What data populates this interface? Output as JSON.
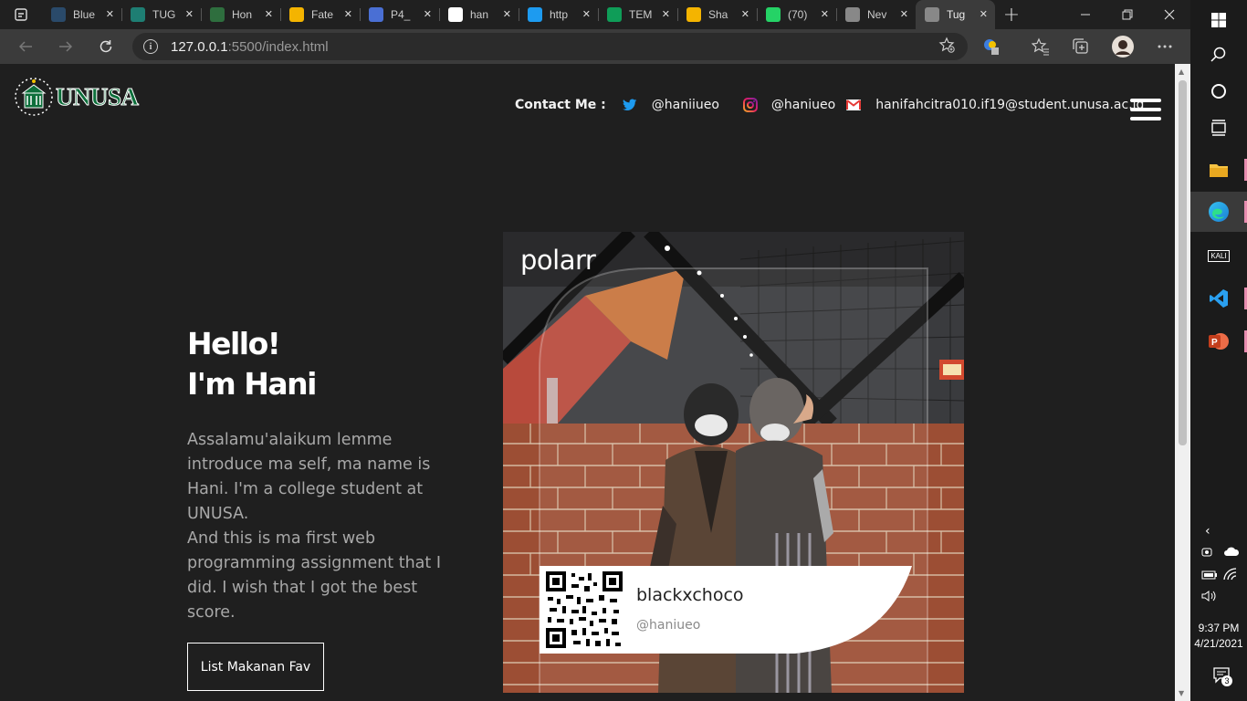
{
  "browser": {
    "tabs": [
      {
        "title": "Blue",
        "icon": "bluetooth-favicon",
        "color": "#2a4a6a"
      },
      {
        "title": "TUG",
        "icon": "classroom-favicon",
        "color": "#1e7e73"
      },
      {
        "title": "Hon",
        "icon": "unusa-favicon",
        "color": "#2e6e3e"
      },
      {
        "title": "Fate",
        "icon": "google-drive-favicon",
        "color": "#f4b400"
      },
      {
        "title": "P4_",
        "icon": "google-docs-favicon",
        "color": "#4a6fd4"
      },
      {
        "title": "han",
        "icon": "github-favicon",
        "color": "#ffffff"
      },
      {
        "title": "http",
        "icon": "twitter-favicon",
        "color": "#1d9bf0"
      },
      {
        "title": "TEM",
        "icon": "google-drive-favicon",
        "color": "#0f9d58"
      },
      {
        "title": "Sha",
        "icon": "google-drive-favicon",
        "color": "#f4b400"
      },
      {
        "title": "(70)",
        "icon": "whatsapp-favicon",
        "color": "#25d366"
      },
      {
        "title": "Nev",
        "icon": "new-tab-favicon",
        "color": "#888888"
      },
      {
        "title": "Tug",
        "icon": "page-favicon",
        "color": "#888888",
        "active": true
      }
    ],
    "address": {
      "host": "127.0.0.1",
      "rest": ":5500/index.html"
    }
  },
  "page": {
    "logo_text": "UNUSA",
    "contact_label": "Contact Me :",
    "twitter_handle": "@haniiueo",
    "instagram_handle": "@haniueo",
    "email": "hanifahcitra010.if19@student.unusa.ac.id",
    "hero": {
      "line1": "Hello!",
      "line2": "I'm Hani",
      "para1": "Assalamu'alaikum lemme introduce ma self, ma name is Hani. I'm a college student at UNUSA.",
      "para2": "And this is ma first web programming assignment that I did. I wish that I got the best score."
    },
    "button_label": "List Makanan Fav",
    "photo": {
      "watermark": "polarr",
      "card_name": "blackxchoco",
      "card_handle": "@haniueo"
    }
  },
  "taskbar": {
    "time": "9:37 PM",
    "date": "4/21/2021",
    "notifications": "3",
    "kali_label": "KALI"
  },
  "colors": {
    "page_bg": "#1f1f1f",
    "accent_green": "#0d6f3b",
    "twitter_blue": "#1d9bf0",
    "instagram_purple": "#c13584",
    "mail_red": "#e53935"
  }
}
